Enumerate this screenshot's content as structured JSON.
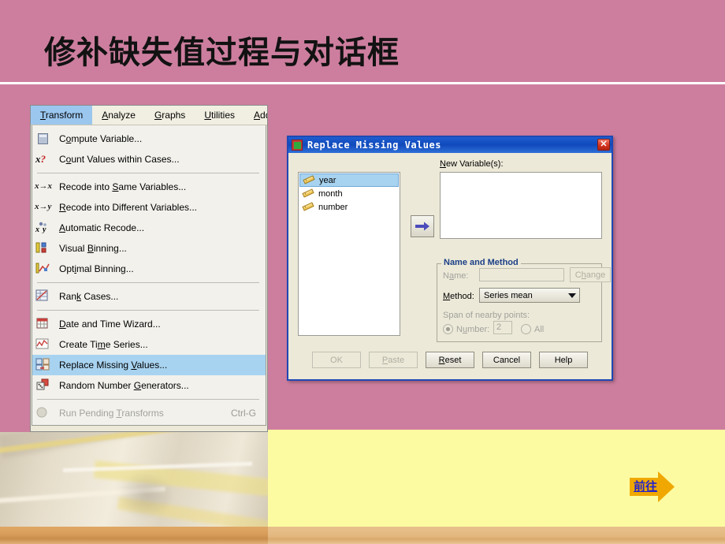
{
  "slide": {
    "title": "修补缺失值过程与对话框",
    "background_color": "#cd7e9e",
    "panel_color": "#fdfba2",
    "divider_color": "#ffffff"
  },
  "goto": {
    "label": "前往",
    "arrow_color": "#f0a800",
    "text_color": "#2222cc"
  },
  "spss_window": {
    "menubar": [
      {
        "label_pre": "",
        "label_key": "T",
        "label_post": "ransform",
        "active": true
      },
      {
        "label_pre": "",
        "label_key": "A",
        "label_post": "nalyze",
        "active": false
      },
      {
        "label_pre": "",
        "label_key": "G",
        "label_post": "raphs",
        "active": false
      },
      {
        "label_pre": "",
        "label_key": "U",
        "label_post": "tilities",
        "active": false
      },
      {
        "label_pre": "",
        "label_key": "A",
        "label_post": "dd",
        "active": false
      }
    ],
    "menu_items": [
      {
        "type": "item",
        "icon": "calculator-icon",
        "pre": "C",
        "key": "o",
        "post": "mpute Variable...",
        "shortcut": "",
        "state": "normal"
      },
      {
        "type": "item",
        "icon": "count-values-icon",
        "pre": "C",
        "key": "o",
        "post": "unt Values within Cases...",
        "shortcut": "",
        "state": "normal"
      },
      {
        "type": "separator"
      },
      {
        "type": "item",
        "icon": "recode-same-icon",
        "pre": "Recode into ",
        "key": "S",
        "post": "ame Variables...",
        "shortcut": "",
        "state": "normal"
      },
      {
        "type": "item",
        "icon": "recode-different-icon",
        "pre": "",
        "key": "R",
        "post": "ecode into Different Variables...",
        "shortcut": "",
        "state": "normal"
      },
      {
        "type": "item",
        "icon": "automatic-recode-icon",
        "pre": "",
        "key": "A",
        "post": "utomatic Recode...",
        "shortcut": "",
        "state": "normal"
      },
      {
        "type": "item",
        "icon": "visual-binning-icon",
        "pre": "Visual ",
        "key": "B",
        "post": "inning...",
        "shortcut": "",
        "state": "normal"
      },
      {
        "type": "item",
        "icon": "optimal-binning-icon",
        "pre": "Opt",
        "key": "i",
        "post": "mal Binning...",
        "shortcut": "",
        "state": "normal"
      },
      {
        "type": "separator"
      },
      {
        "type": "item",
        "icon": "rank-cases-icon",
        "pre": "Ran",
        "key": "k",
        "post": " Cases...",
        "shortcut": "",
        "state": "normal"
      },
      {
        "type": "separator"
      },
      {
        "type": "item",
        "icon": "date-time-wizard-icon",
        "pre": "",
        "key": "D",
        "post": "ate and Time Wizard...",
        "shortcut": "",
        "state": "normal"
      },
      {
        "type": "item",
        "icon": "create-time-series-icon",
        "pre": "Create Ti",
        "key": "m",
        "post": "e Series...",
        "shortcut": "",
        "state": "normal"
      },
      {
        "type": "item",
        "icon": "replace-missing-values-icon",
        "pre": "Replace Missing ",
        "key": "V",
        "post": "alues...",
        "shortcut": "",
        "state": "selected"
      },
      {
        "type": "item",
        "icon": "random-number-generators-icon",
        "pre": "Random Number ",
        "key": "G",
        "post": "enerators...",
        "shortcut": "",
        "state": "normal"
      },
      {
        "type": "separator"
      },
      {
        "type": "item",
        "icon": "run-pending-transforms-icon",
        "pre": "Run Pending ",
        "key": "T",
        "post": "ransforms",
        "shortcut": "Ctrl-G",
        "state": "disabled"
      }
    ]
  },
  "dialog": {
    "title": "Replace Missing Values",
    "close_label": "✕",
    "variables": [
      {
        "name": "year",
        "icon": "scale-variable-icon",
        "selected": true
      },
      {
        "name": "month",
        "icon": "scale-variable-icon",
        "selected": false
      },
      {
        "name": "number",
        "icon": "scale-variable-icon",
        "selected": false
      }
    ],
    "transfer_arrow": "right-arrow-icon",
    "new_variables": {
      "label_key": "N",
      "label_rest": "ew Variable(s):",
      "items": []
    },
    "name_and_method": {
      "group_title": "Name and Method",
      "name_label_pre": "N",
      "name_label_key": "a",
      "name_label_post": "me:",
      "name_value": "",
      "change_label_pre": "C",
      "change_label_key": "h",
      "change_label_post": "ange",
      "method_label_pre": "",
      "method_label_key": "M",
      "method_label_post": "ethod:",
      "method_value": "Series mean",
      "span_label": "Span of nearby points:",
      "number_label_pre": "N",
      "number_label_key": "u",
      "number_label_post": "mber:",
      "number_value": "2",
      "number_selected": true,
      "all_label": "All",
      "all_selected": false
    },
    "buttons": [
      {
        "label": "OK",
        "state": "disabled",
        "key": ""
      },
      {
        "label": "Paste",
        "state": "disabled",
        "key": "P"
      },
      {
        "label": "Reset",
        "state": "normal",
        "key": "R"
      },
      {
        "label": "Cancel",
        "state": "normal",
        "key": ""
      },
      {
        "label": "Help",
        "state": "normal",
        "key": ""
      }
    ]
  }
}
